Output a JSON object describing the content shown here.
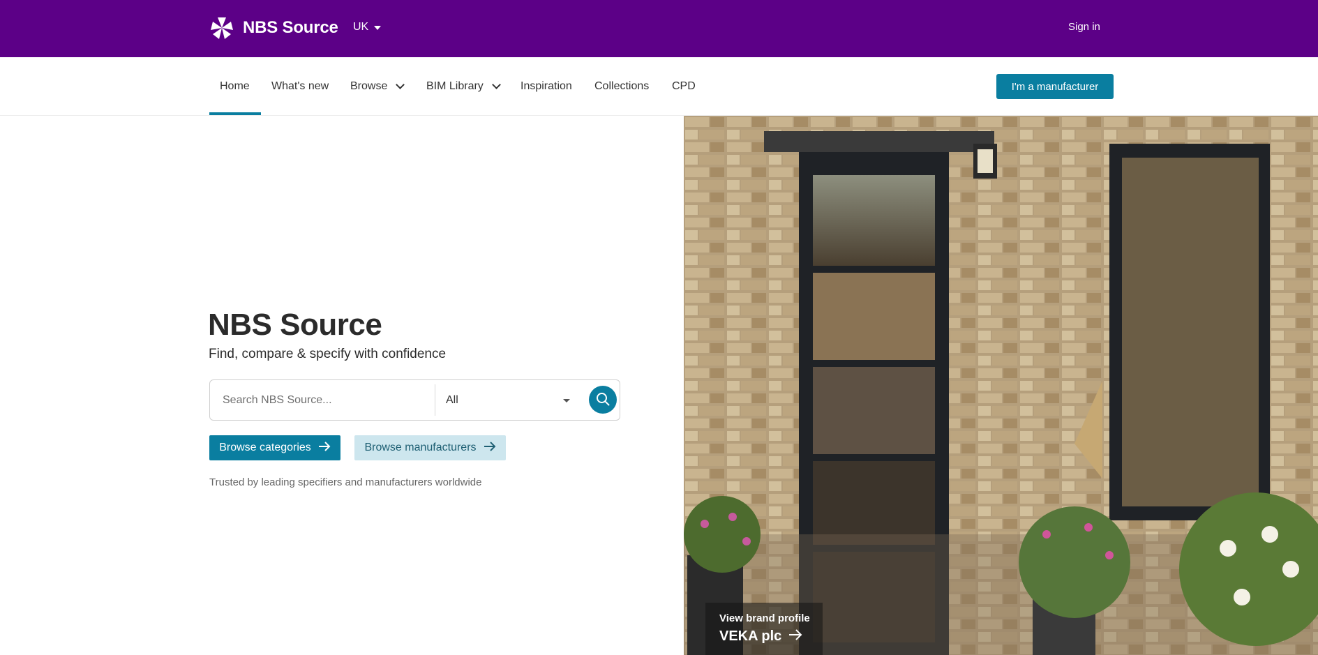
{
  "header": {
    "brand": "NBS Source",
    "region": "UK",
    "sign_in": "Sign in"
  },
  "nav": {
    "items": [
      {
        "label": "Home",
        "active": true
      },
      {
        "label": "What's new"
      },
      {
        "label": "Browse",
        "dropdown": true
      },
      {
        "label": "BIM Library",
        "dropdown": true
      },
      {
        "label": "Inspiration"
      },
      {
        "label": "Collections"
      },
      {
        "label": "CPD"
      }
    ],
    "cta": "I'm a manufacturer"
  },
  "hero": {
    "title": "NBS Source",
    "subtitle": "Find, compare & specify with confidence",
    "search": {
      "placeholder": "Search NBS Source...",
      "filter_value": "All"
    },
    "browse_categories": "Browse categories",
    "browse_manufacturers": "Browse manufacturers",
    "trusted": "Trusted by leading specifiers and manufacturers worldwide"
  },
  "brand_card": {
    "label": "View brand profile",
    "name": "VEKA plc"
  },
  "colors": {
    "header_bg": "#5c0087",
    "accent": "#0a7ea0",
    "secondary_btn_bg": "#cde6ee"
  }
}
